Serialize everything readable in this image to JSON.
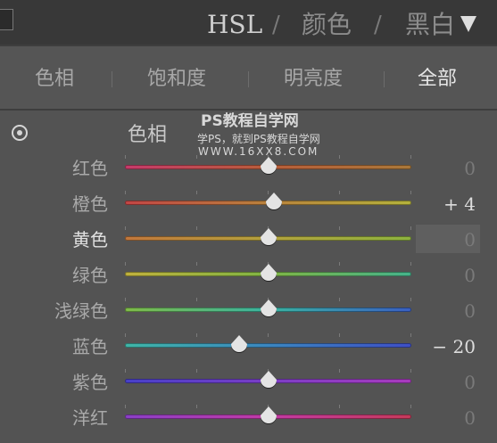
{
  "header": {
    "title_hsl": "HSL",
    "separator": "/",
    "title_color": "颜色",
    "title_bw": "黑白"
  },
  "tabs": [
    {
      "label": "色相"
    },
    {
      "label": "饱和度"
    },
    {
      "label": "明亮度"
    },
    {
      "label": "全部",
      "active": true
    }
  ],
  "section": {
    "label": "色相"
  },
  "watermark": {
    "line1": "PS教程自学网",
    "line2": "学PS，就到PS教程自学网",
    "line3": "WWW.16XX8.COM"
  },
  "sliders": [
    {
      "label": "红色",
      "value": "0",
      "amount": 0,
      "gradient": [
        "#c63a6a",
        "#b85d3a",
        "#a9783a"
      ]
    },
    {
      "label": "橙色",
      "value": "+ 4",
      "amount": 4,
      "gradient": [
        "#c24545",
        "#b8823c",
        "#b4b23c"
      ]
    },
    {
      "label": "黄色",
      "value": "0",
      "amount": 0,
      "gradient": [
        "#c2773c",
        "#b3a23d",
        "#8db33f"
      ],
      "active": true
    },
    {
      "label": "绿色",
      "value": "0",
      "amount": 0,
      "gradient": [
        "#c0b13d",
        "#7fb444",
        "#45b38b"
      ]
    },
    {
      "label": "浅绿色",
      "value": "0",
      "amount": 0,
      "gradient": [
        "#7fbb48",
        "#3ab3a0",
        "#3a5fc2"
      ]
    },
    {
      "label": "蓝色",
      "value": "− 20",
      "amount": -20,
      "gradient": [
        "#3fb6a7",
        "#3b86c0",
        "#3e4fc6"
      ]
    },
    {
      "label": "紫色",
      "value": "0",
      "amount": 0,
      "gradient": [
        "#4740c8",
        "#7b3ec6",
        "#a93bbd"
      ]
    },
    {
      "label": "洋红",
      "value": "0",
      "amount": 0,
      "gradient": [
        "#8b3fc7",
        "#c23aa5",
        "#c63a5a"
      ]
    }
  ]
}
